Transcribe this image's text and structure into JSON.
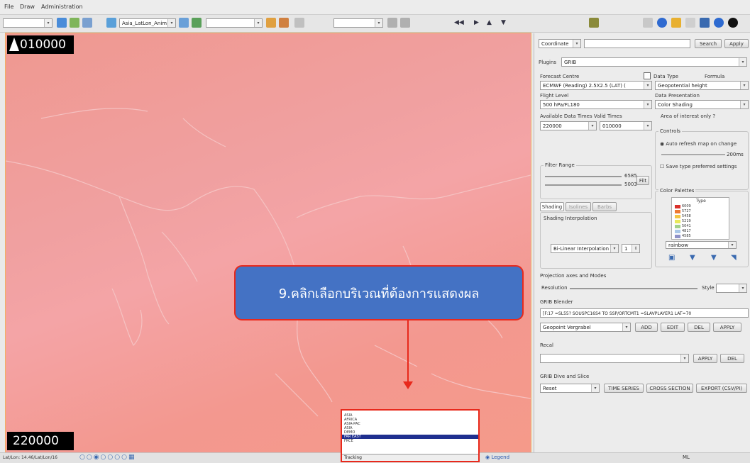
{
  "menubar": {
    "items": [
      "File",
      "Draw",
      "Administration"
    ]
  },
  "toolbar": {
    "combo1": "",
    "combo2": "Asia_LatLon_Anim",
    "combo3": "",
    "combo4": "",
    "combo5": ""
  },
  "map": {
    "top_value": "010000",
    "bottom_value": "220000",
    "border_color": "#f2b060",
    "fill_color": "#f0a0a0"
  },
  "panel": {
    "coord_combo": "Coordinate",
    "search_button": "Search",
    "apply_button": "Apply",
    "plugins_label": "Plugins",
    "plugins_value": "GRIB",
    "forecast_centre_label": "Forecast Centre",
    "data_type_label": "Data Type",
    "formula_label": "Formula",
    "forecast_centre_value": "ECMWF (Reading) 2.5X2.5 (LAT) (",
    "data_type_value": "Geopotential height",
    "flight_level_label": "Flight Level",
    "data_presentation_label": "Data Presentation",
    "flight_level_value": "500 hPa/FL180",
    "data_presentation_value": "Color Shading",
    "available_times_label": "Available Data Times Valid Times",
    "area_only_label": "Area of interest only ?",
    "time_value1": "220000",
    "time_value2": "010000",
    "controls_label": "Controls",
    "auto_refresh_label": "Auto refresh map on change",
    "timer_label": "200ms",
    "save_pref_label": "Save type preferred settings",
    "filter_range_label": "Filter Range",
    "filter_max": "6585",
    "filter_min": "5003",
    "filter_button": "Filt",
    "tab_shading": "Shading",
    "tab_isolines": "Isolines",
    "tab_barbs": "Barbs",
    "shading_interp_label": "Shading Interpolation",
    "interp_value": "Bi-Linear Interpolation",
    "interp_num": "1",
    "color_palette_label": "Color Palettes",
    "palette_type_label": "Type",
    "palette_values": [
      "6009",
      "5727",
      "5458",
      "5219",
      "5041",
      "4817",
      "4585"
    ],
    "palette_colors": [
      "#d9312b",
      "#ee7a33",
      "#f3c542",
      "#e8e85a",
      "#a2d08a",
      "#a9c7e8",
      "#8f92c9"
    ],
    "palette_combo": "rainbow",
    "projection_label": "Projection axes and Modes",
    "resolution_label": "Resolution",
    "style_label": "Style",
    "grib_blender_label": "GRIB Blender",
    "blender_text": "[F:17 =SL55?  SOUSPC16S4 TO SSP/ORTCMT1 =SLAVPLAYER1 LAT=70",
    "blender_combo": "Geopoint Vergrabel",
    "add_button": "ADD",
    "edit_button": "EDIT",
    "del_button": "DEL",
    "apply2_button": "APPLY",
    "recal_label": "Recal",
    "apply3_button": "APPLY",
    "del2_button": "DEL",
    "slice_label": "GRIB Dive and Slice",
    "slice_combo": "Reset",
    "time_series_button": "TIME SERIES",
    "cross_section_button": "CROSS SECTION",
    "export_button": "EXPORT (CSV/PI)"
  },
  "callout": {
    "text": "9.คลิกเลือกบริเวณที่ต้องการแสดงผล"
  },
  "dropdown": {
    "options": [
      "ASIA",
      "AFRICA",
      "ASIA-PAC",
      "ASIA",
      "DEMO",
      "FAR EAST",
      "FRCE"
    ],
    "selected_index": 5,
    "current_value": "Tracking"
  },
  "statusbar": {
    "left_text": "Lat/Lon: 14.46/Lat/Lon/16",
    "legend_label": "Legend",
    "right_text": "ML"
  }
}
